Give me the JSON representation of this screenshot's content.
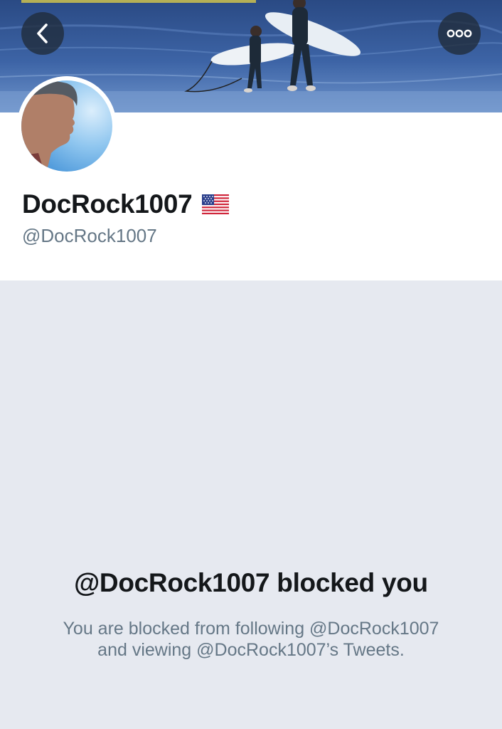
{
  "header": {
    "back_icon": "chevron-left-icon",
    "more_icon": "more-options-icon",
    "button_background": "#202c3a"
  },
  "profile": {
    "display_name": "DocRock1007",
    "flag_icon": "us-flag-icon",
    "handle": "@DocRock1007"
  },
  "blocked": {
    "title": "@DocRock1007 blocked you",
    "description_line1": "You are blocked from following @DocRock1007",
    "description_line2": "and viewing @DocRock1007’s Tweets."
  },
  "colors": {
    "text_primary": "#14171a",
    "text_secondary": "#657786",
    "panel_background": "#e6e9f0",
    "header_background": "#ffffff"
  }
}
